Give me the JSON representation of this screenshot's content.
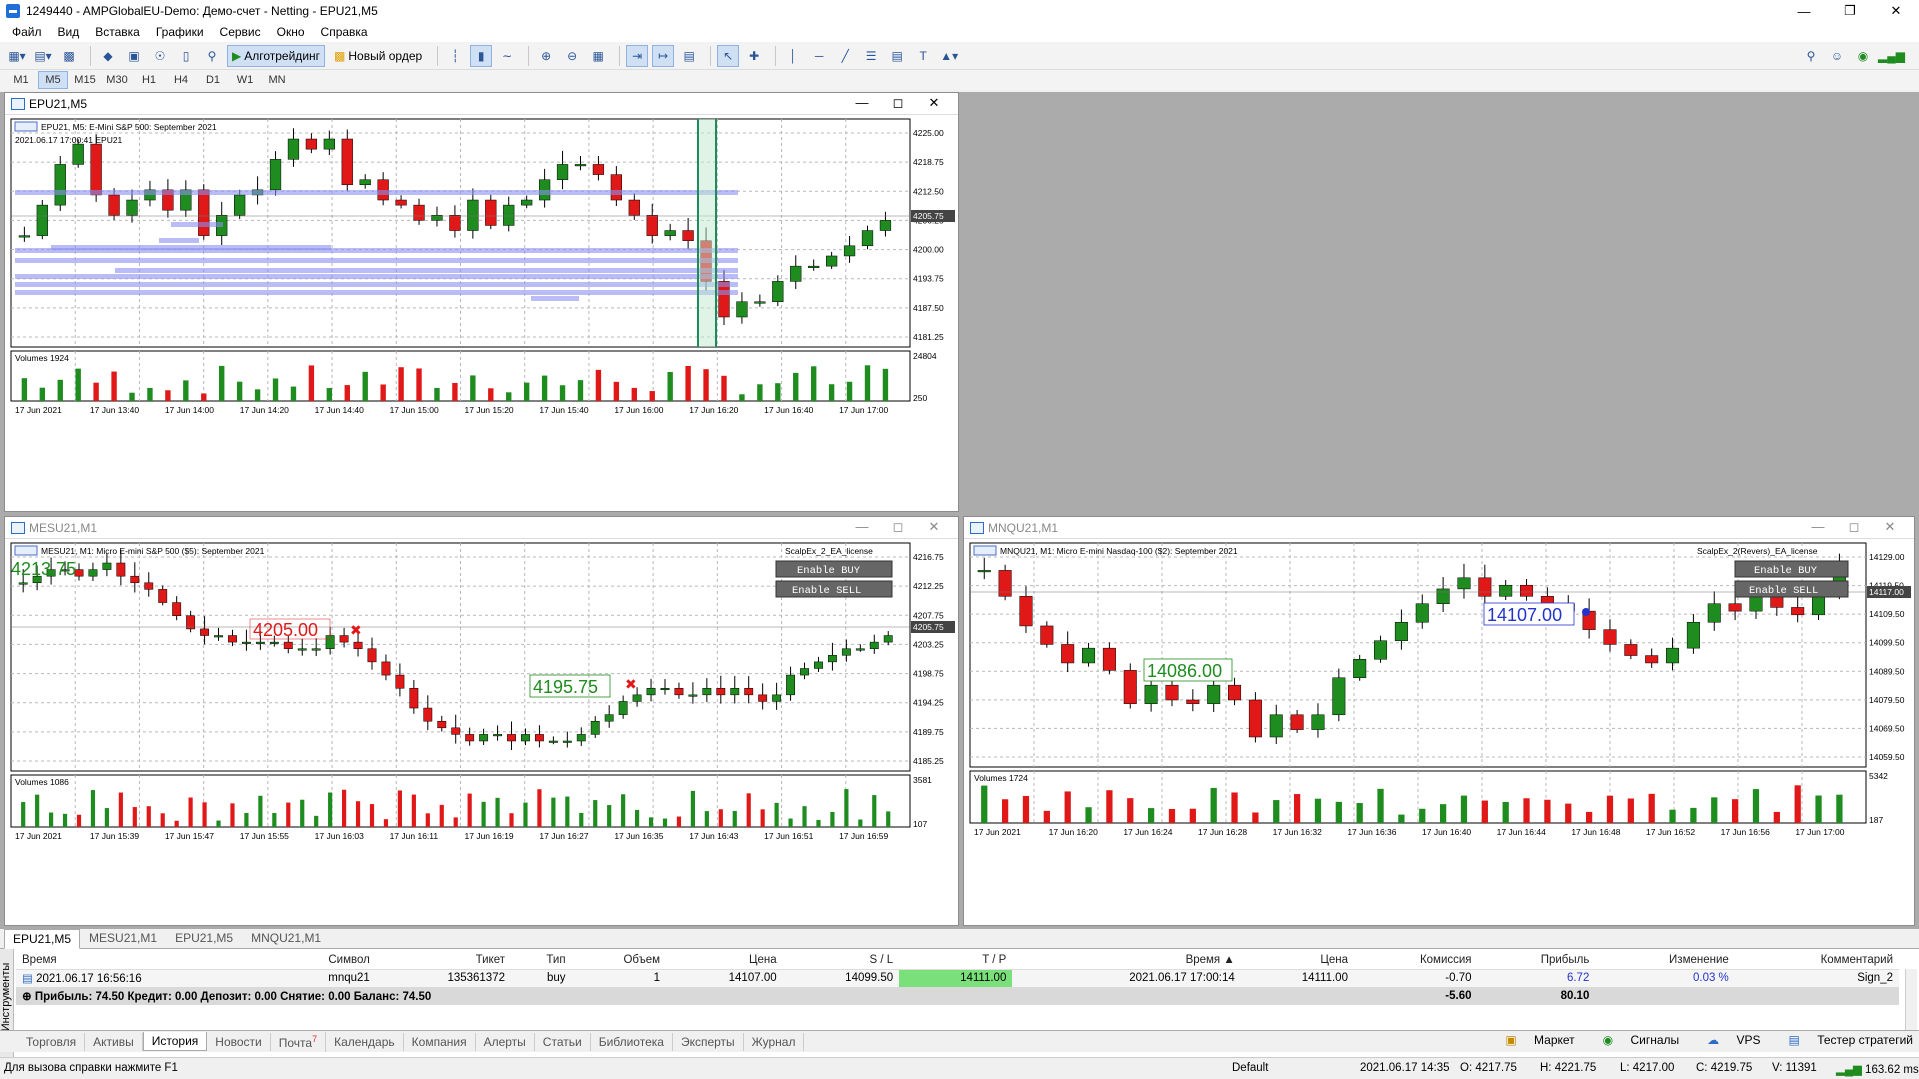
{
  "window": {
    "title": "1249440 - AMPGlobalEU-Demo: Демо-счет - Netting - EPU21,M5"
  },
  "menu": [
    "Файл",
    "Вид",
    "Вставка",
    "Графики",
    "Сервис",
    "Окно",
    "Справка"
  ],
  "toolbar": {
    "algo_label": "Алготрейдинг",
    "new_order_label": "Новый ордер"
  },
  "timeframes": [
    "M1",
    "M5",
    "M15",
    "M30",
    "H1",
    "H4",
    "D1",
    "W1",
    "MN"
  ],
  "active_timeframe": "M5",
  "charts": {
    "main": {
      "window_title": "EPU21,M5",
      "header": "EPU21, M5:  E-Mini S&P 500: September 2021",
      "sub": "2021.06.17 17:00:41 EPU21",
      "price_labels": [
        "4225.00",
        "4218.75",
        "4212.50",
        "4206.25",
        "4200.00",
        "4193.75",
        "4187.50",
        "4181.25"
      ],
      "current_price": "4205.75",
      "volumes_label": "Volumes 1924",
      "vol_max": "24804",
      "vol_min": "250",
      "time_labels": [
        "17 Jun 2021",
        "17 Jun 13:40",
        "17 Jun 14:00",
        "17 Jun 14:20",
        "17 Jun 14:40",
        "17 Jun 15:00",
        "17 Jun 15:20",
        "17 Jun 15:40",
        "17 Jun 16:00",
        "17 Jun 16:20",
        "17 Jun 16:40",
        "17 Jun 17:00"
      ]
    },
    "mes": {
      "window_title": "MESU21,M1",
      "header": "MESU21, M1:  Micro E-mini S&P 500 ($5): September 2021",
      "ea_label": "ScalpEx_2_EA_license",
      "enable_buy": "Enable  BUY",
      "enable_sell": "Enable  SELL",
      "price_labels": [
        "4216.75",
        "4212.25",
        "4207.75",
        "4203.25",
        "4198.75",
        "4194.25",
        "4189.75",
        "4185.25"
      ],
      "current_price": "4205.75",
      "trade_labels": [
        "4213.75",
        "4205.00",
        "4195.75"
      ],
      "volumes_label": "Volumes 1086",
      "vol_max": "3581",
      "vol_min": "107",
      "time_labels": [
        "17 Jun 2021",
        "17 Jun 15:39",
        "17 Jun 15:47",
        "17 Jun 15:55",
        "17 Jun 16:03",
        "17 Jun 16:11",
        "17 Jun 16:19",
        "17 Jun 16:27",
        "17 Jun 16:35",
        "17 Jun 16:43",
        "17 Jun 16:51",
        "17 Jun 16:59"
      ]
    },
    "mnq": {
      "window_title": "MNQU21,M1",
      "header": "MNQU21, M1:  Micro E-mini Nasdaq-100 ($2): September 2021",
      "ea_label": "ScalpEx_2(Revers)_EA_license",
      "enable_buy": "Enable  BUY",
      "enable_sell": "Enable  SELL",
      "price_labels": [
        "14129.00",
        "14119.50",
        "14109.50",
        "14099.50",
        "14089.50",
        "14079.50",
        "14069.50",
        "14059.50"
      ],
      "current_price": "14117.00",
      "trade_labels": [
        "14107.00",
        "14086.00"
      ],
      "volumes_label": "Volumes 1724",
      "vol_max": "5342",
      "vol_min": "187",
      "time_labels": [
        "17 Jun 2021",
        "17 Jun 16:20",
        "17 Jun 16:24",
        "17 Jun 16:28",
        "17 Jun 16:32",
        "17 Jun 16:36",
        "17 Jun 16:40",
        "17 Jun 16:44",
        "17 Jun 16:48",
        "17 Jun 16:52",
        "17 Jun 16:56",
        "17 Jun 17:00"
      ]
    }
  },
  "chart_tabs": [
    "EPU21,M5",
    "MESU21,M1",
    "EPU21,M5",
    "MNQU21,M1"
  ],
  "table": {
    "headers": [
      "Время",
      "Символ",
      "Тикет",
      "Тип",
      "Объем",
      "Цена",
      "S / L",
      "T / P",
      "Время",
      "Цена",
      "Комиссия",
      "Прибыль",
      "Изменение",
      "Комментарий"
    ],
    "row": [
      "2021.06.17 16:56:16",
      "mnqu21",
      "135361372",
      "buy",
      "1",
      "14107.00",
      "14099.50",
      "14111.00",
      "2021.06.17 17:00:14",
      "14111.00",
      "-0.70",
      "6.72",
      "0.03 %",
      "Sign_2"
    ],
    "summary": "Прибыль: 74.50  Кредит: 0.00  Депозит: 0.00  Снятие: 0.00  Баланс: 74.50",
    "summary_commission": "-5.60",
    "summary_profit": "80.10"
  },
  "side_label": "Инструменты",
  "bottom_tabs": [
    "Торговля",
    "Активы",
    "История",
    "Новости",
    "Почта",
    "Календарь",
    "Компания",
    "Алерты",
    "Статьи",
    "Библиотека",
    "Эксперты",
    "Журнал"
  ],
  "mail_count": "7",
  "bottom_right": [
    "Маркет",
    "Сигналы",
    "VPS",
    "Тестер стратегий"
  ],
  "status": {
    "help": "Для вызова справки нажмите F1",
    "profile": "Default",
    "datetime": "2021.06.17 14:35",
    "open": "O: 4217.75",
    "high": "H: 4221.75",
    "low": "L: 4217.00",
    "close": "C: 4219.75",
    "vol": "V: 11391",
    "ping": "163.62 ms"
  },
  "colors": {
    "bull": "#1e8c1e",
    "bear": "#e01818",
    "band": "#8b8ff0",
    "grid": "#b8b8b8"
  }
}
